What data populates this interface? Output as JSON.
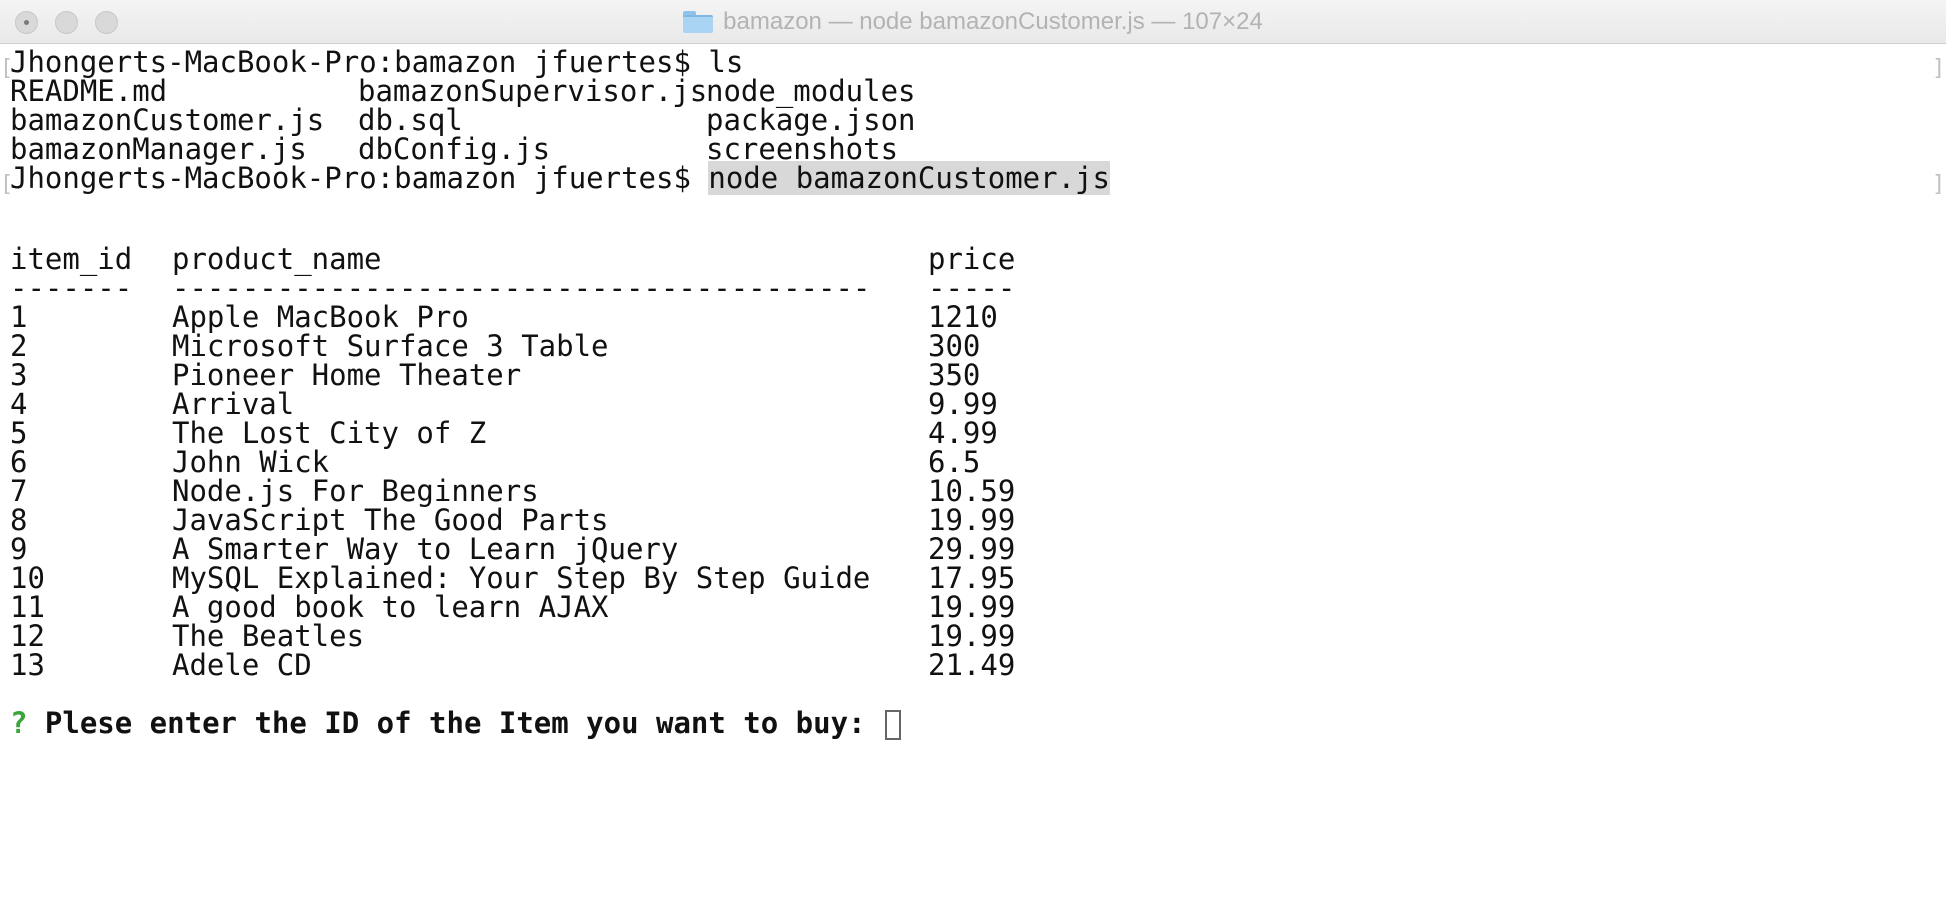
{
  "window": {
    "title": "bamazon — node bamazonCustomer.js — 107×24",
    "folder_icon": "folder-icon"
  },
  "terminal": {
    "prompt": "Jhongerts-MacBook-Pro:bamazon jfuertes$ ",
    "cmd1": "ls",
    "ls_rows": [
      [
        "README.md",
        "bamazonSupervisor.js",
        "node_modules"
      ],
      [
        "bamazonCustomer.js",
        "db.sql",
        "package.json"
      ],
      [
        "bamazonManager.js",
        "dbConfig.js",
        "screenshots"
      ]
    ],
    "cmd2": "node bamazonCustomer.js",
    "table": {
      "headers": [
        "item_id",
        "product_name",
        "price"
      ],
      "dashes": [
        "-------",
        "----------------------------------------",
        "-----"
      ],
      "rows": [
        [
          "1",
          "Apple MacBook Pro",
          "1210"
        ],
        [
          "2",
          "Microsoft Surface 3 Table",
          "300"
        ],
        [
          "3",
          "Pioneer Home Theater",
          "350"
        ],
        [
          "4",
          "Arrival",
          "9.99"
        ],
        [
          "5",
          "The Lost City of Z",
          "4.99"
        ],
        [
          "6",
          "John Wick",
          "6.5"
        ],
        [
          "7",
          "Node.js For Beginners",
          "10.59"
        ],
        [
          "8",
          "JavaScript The Good Parts",
          "19.99"
        ],
        [
          "9",
          "A Smarter Way to Learn jQuery",
          "29.99"
        ],
        [
          "10",
          "MySQL Explained: Your Step By Step Guide",
          "17.95"
        ],
        [
          "11",
          "A good book to learn AJAX",
          "19.99"
        ],
        [
          "12",
          "The Beatles",
          "19.99"
        ],
        [
          "13",
          "Adele CD",
          "21.49"
        ]
      ]
    },
    "question_mark": "?",
    "question": " Plese enter the ID of the Item you want to buy: ",
    "input_value": ""
  },
  "colors": {
    "prompt_green": "#3aa63a",
    "selection": "#d8d8d8"
  }
}
